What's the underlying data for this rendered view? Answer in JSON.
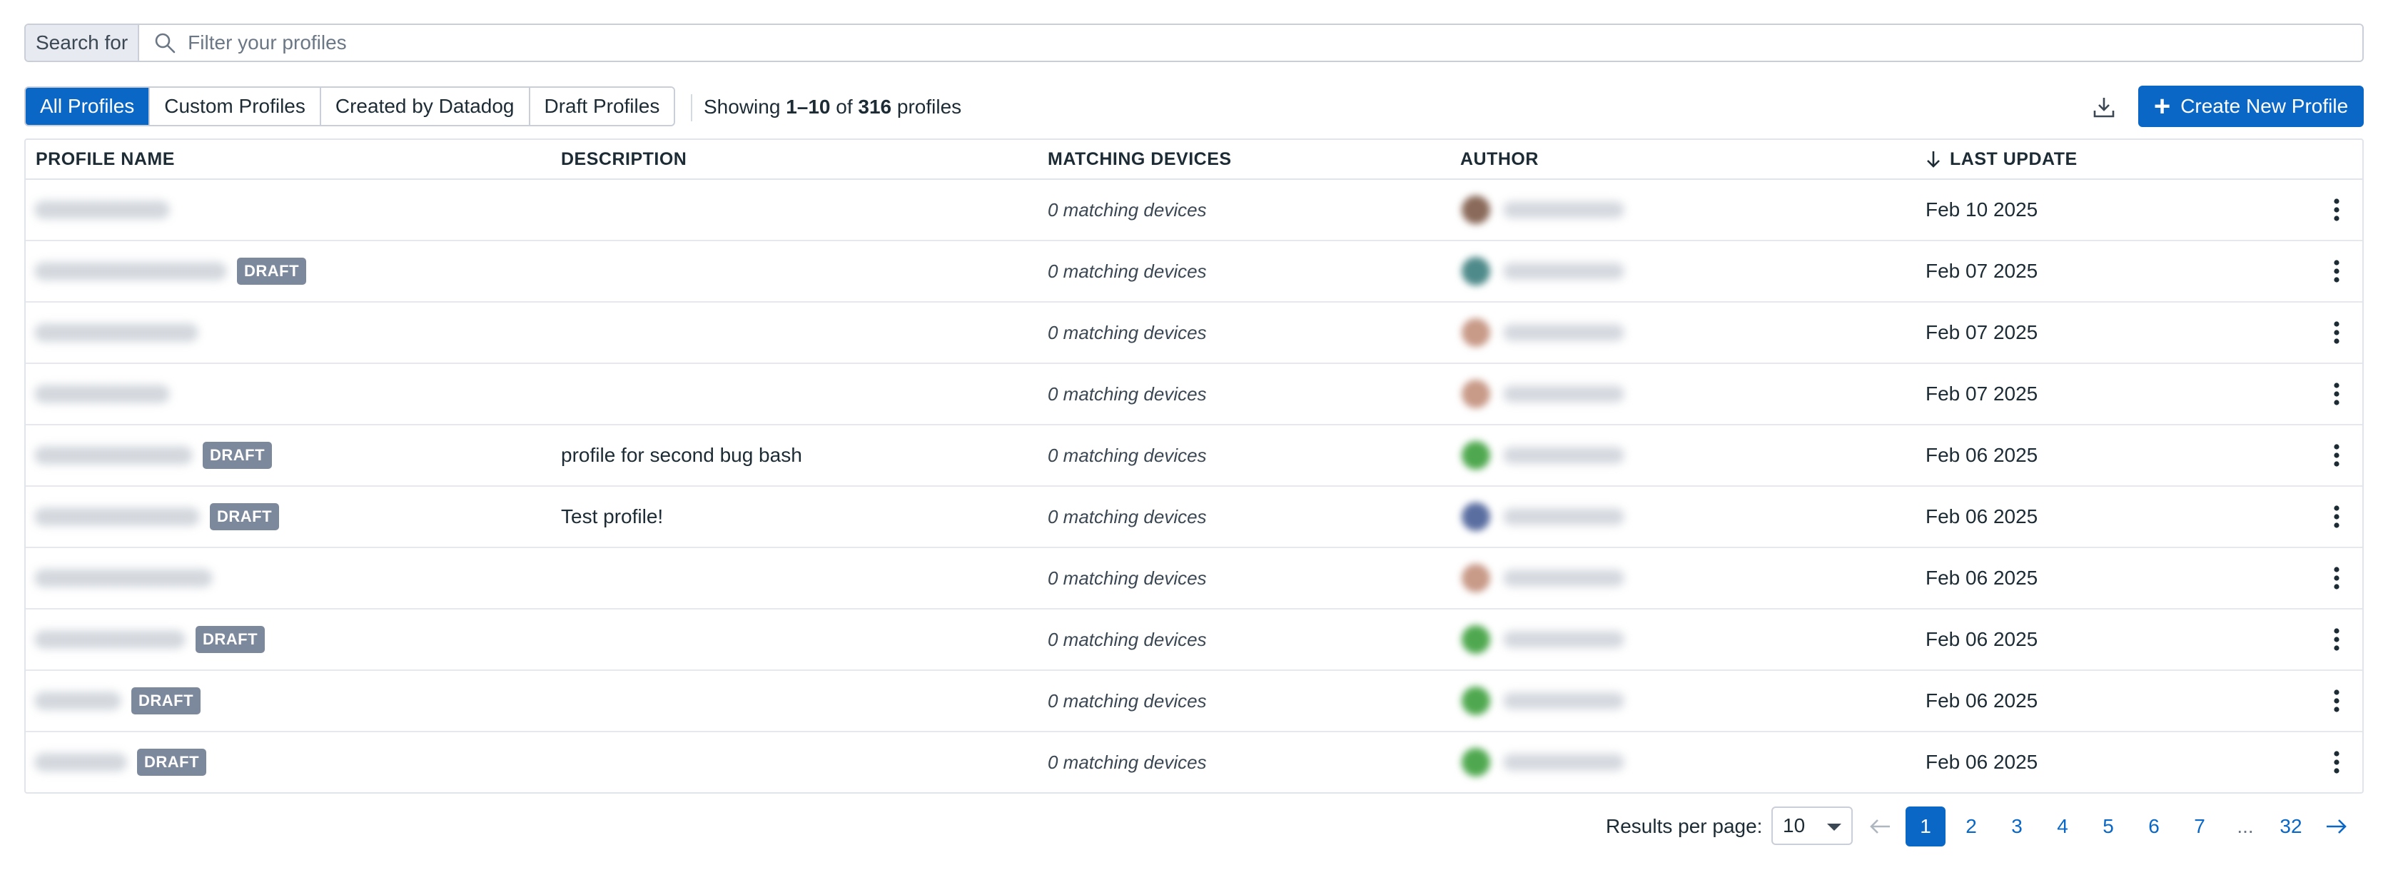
{
  "search": {
    "prefix": "Search for",
    "placeholder": "Filter your profiles",
    "value": ""
  },
  "filters": [
    {
      "label": "All Profiles",
      "active": true
    },
    {
      "label": "Custom Profiles",
      "active": false
    },
    {
      "label": "Created by Datadog",
      "active": false
    },
    {
      "label": "Draft Profiles",
      "active": false
    }
  ],
  "summary": {
    "prefix": "Showing ",
    "range": "1–10",
    "of": " of ",
    "total": "316",
    "suffix": " profiles"
  },
  "actions": {
    "create_label": "Create New Profile",
    "download_icon": "download-icon",
    "plus_icon": "plus-icon"
  },
  "table": {
    "columns": {
      "profile_name": "PROFILE NAME",
      "description": "DESCRIPTION",
      "matching_devices": "MATCHING DEVICES",
      "author": "AUTHOR",
      "last_update": "LAST UPDATE"
    },
    "sort_icon": "arrow-down-icon",
    "rows": [
      {
        "draft": false,
        "description": "",
        "matching": "0 matching devices",
        "updated": "Feb 10 2025",
        "avatar_color": "#8a6a5a"
      },
      {
        "draft": true,
        "draft_label": "DRAFT",
        "description": "",
        "matching": "0 matching devices",
        "updated": "Feb 07 2025",
        "avatar_color": "#4f8a8a"
      },
      {
        "draft": false,
        "description": "",
        "matching": "0 matching devices",
        "updated": "Feb 07 2025",
        "avatar_color": "#c89a88"
      },
      {
        "draft": false,
        "description": "",
        "matching": "0 matching devices",
        "updated": "Feb 07 2025",
        "avatar_color": "#c89a88"
      },
      {
        "draft": true,
        "draft_label": "DRAFT",
        "description": "profile for second bug bash",
        "matching": "0 matching devices",
        "updated": "Feb 06 2025",
        "avatar_color": "#4fa84f"
      },
      {
        "draft": true,
        "draft_label": "DRAFT",
        "description": "Test profile!",
        "matching": "0 matching devices",
        "updated": "Feb 06 2025",
        "avatar_color": "#5a6ea0"
      },
      {
        "draft": false,
        "description": "",
        "matching": "0 matching devices",
        "updated": "Feb 06 2025",
        "avatar_color": "#c89a88"
      },
      {
        "draft": true,
        "draft_label": "DRAFT",
        "description": "",
        "matching": "0 matching devices",
        "updated": "Feb 06 2025",
        "avatar_color": "#4fa84f"
      },
      {
        "draft": true,
        "draft_label": "DRAFT",
        "description": "",
        "matching": "0 matching devices",
        "updated": "Feb 06 2025",
        "avatar_color": "#4fa84f"
      },
      {
        "draft": true,
        "draft_label": "DRAFT",
        "description": "",
        "matching": "0 matching devices",
        "updated": "Feb 06 2025",
        "avatar_color": "#4fa84f"
      }
    ]
  },
  "pagination": {
    "label": "Results per page:",
    "per_page": "10",
    "prev_icon": "arrow-left-icon",
    "next_icon": "arrow-right-icon",
    "pages": [
      "1",
      "2",
      "3",
      "4",
      "5",
      "6",
      "7",
      "...",
      "32"
    ],
    "current": "1"
  },
  "colors": {
    "accent": "#0b67c5",
    "draft_badge": "#7c889b"
  }
}
